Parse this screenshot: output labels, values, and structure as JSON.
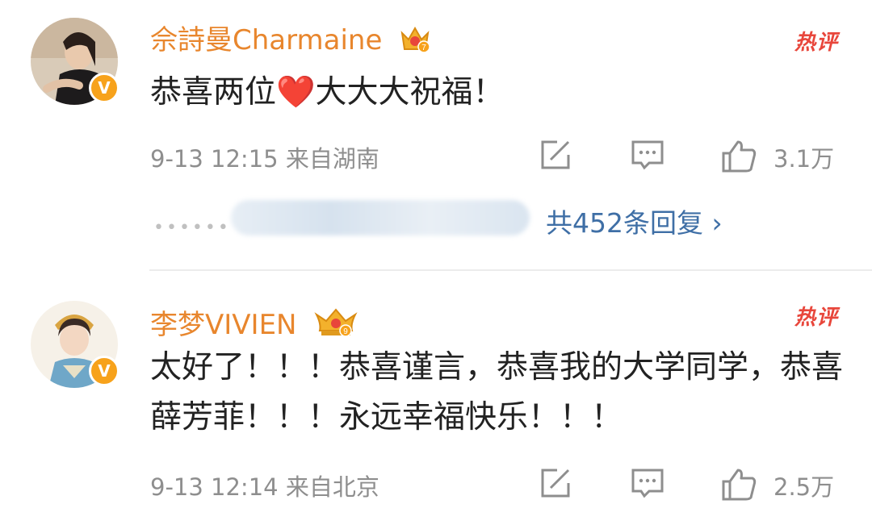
{
  "comments": [
    {
      "user": "佘詩曼Charmaine",
      "hot_label": "热评",
      "text": "恭喜两位❤️大大大祝福！",
      "time": "9-13 12:15",
      "location": "来自湖南",
      "likes": "3.1万",
      "reply_summary": "共452条回复",
      "reply_chevron": "›",
      "verified": "V",
      "crown_level": "7"
    },
    {
      "user": "李梦VIVIEN",
      "hot_label": "热评",
      "text": "太好了！！！恭喜谨言，恭喜我的大学同学，恭喜薛芳菲！！！永远幸福快乐！！！",
      "time": "9-13 12:14",
      "location": "来自北京",
      "likes": "2.5万",
      "verified": "V",
      "crown_level": "9"
    }
  ],
  "icons": {
    "share": "share-icon",
    "comment": "comment-icon",
    "like": "like-icon"
  },
  "colors": {
    "username": "#e8862d",
    "hot": "#e8463b",
    "reply_link": "#3f6fa6",
    "meta": "#8e8e8e",
    "verified_badge": "#f7a21b"
  }
}
